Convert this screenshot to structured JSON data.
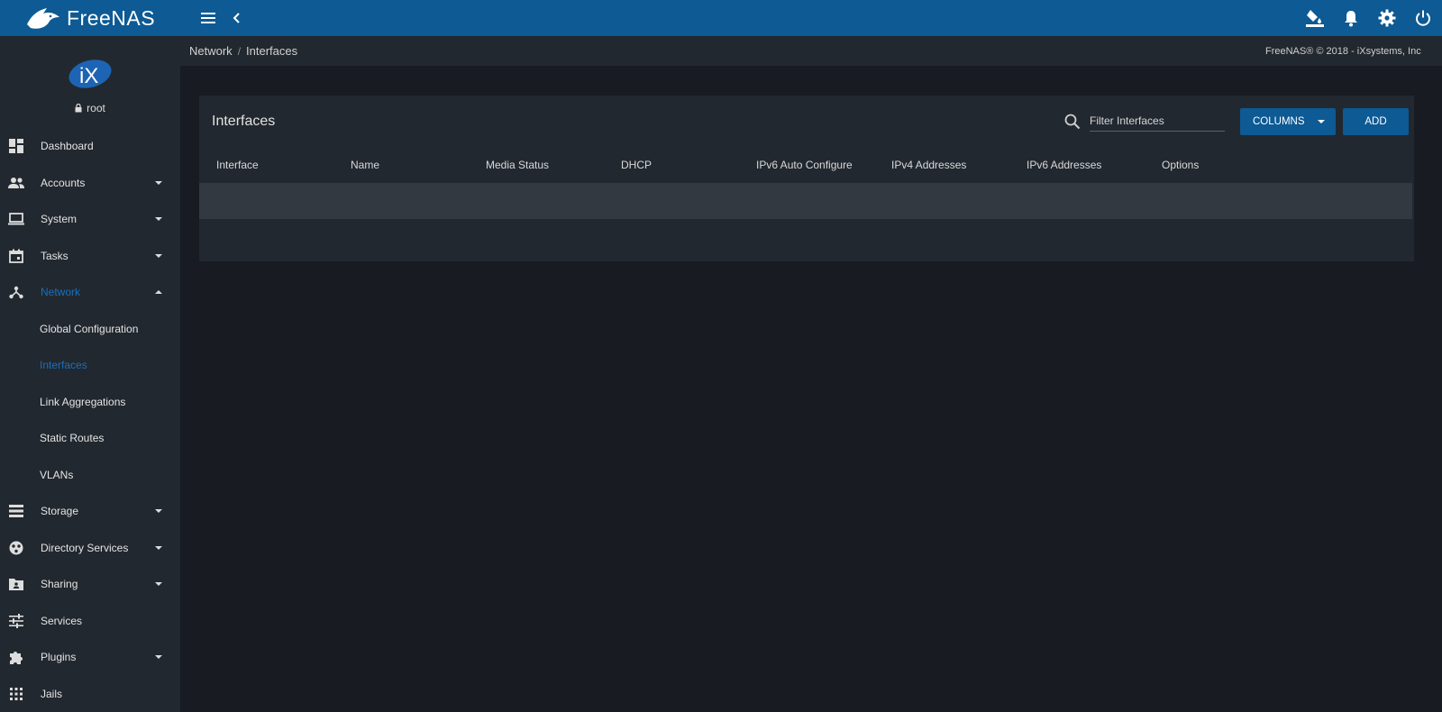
{
  "app": {
    "brand": "FreeNAS",
    "user": "root"
  },
  "breadcrumb": {
    "section": "Network",
    "separator": "/",
    "page": "Interfaces"
  },
  "copyright": "FreeNAS® © 2018 - iXsystems, Inc",
  "sidebar": {
    "items": [
      {
        "label": "Dashboard",
        "icon": "dashboard-icon",
        "expandable": false
      },
      {
        "label": "Accounts",
        "icon": "people-icon",
        "expandable": true
      },
      {
        "label": "System",
        "icon": "laptop-icon",
        "expandable": true
      },
      {
        "label": "Tasks",
        "icon": "calendar-icon",
        "expandable": true
      },
      {
        "label": "Network",
        "icon": "network-icon",
        "expandable": true,
        "expanded": true,
        "active": true
      }
    ],
    "network_subitems": [
      {
        "label": "Global Configuration"
      },
      {
        "label": "Interfaces",
        "active": true
      },
      {
        "label": "Link Aggregations"
      },
      {
        "label": "Static Routes"
      },
      {
        "label": "VLANs"
      }
    ],
    "items_after": [
      {
        "label": "Storage",
        "icon": "storage-icon",
        "expandable": true
      },
      {
        "label": "Directory Services",
        "icon": "directory-icon",
        "expandable": true
      },
      {
        "label": "Sharing",
        "icon": "folder-shared-icon",
        "expandable": true
      },
      {
        "label": "Services",
        "icon": "tune-icon",
        "expandable": false
      },
      {
        "label": "Plugins",
        "icon": "extension-icon",
        "expandable": true
      },
      {
        "label": "Jails",
        "icon": "apps-grid-icon",
        "expandable": false
      }
    ]
  },
  "card": {
    "title": "Interfaces",
    "filter_placeholder": "Filter Interfaces",
    "columns_label": "COLUMNS",
    "add_label": "ADD",
    "columns": [
      "Interface",
      "Name",
      "Media Status",
      "DHCP",
      "IPv6 Auto Configure",
      "IPv4 Addresses",
      "IPv6 Addresses",
      "Options"
    ]
  },
  "colors": {
    "topbar": "#0d5a94",
    "sidebar": "#22282f",
    "background": "#181c22",
    "accent": "#1a6fc0",
    "row": "#333941"
  }
}
